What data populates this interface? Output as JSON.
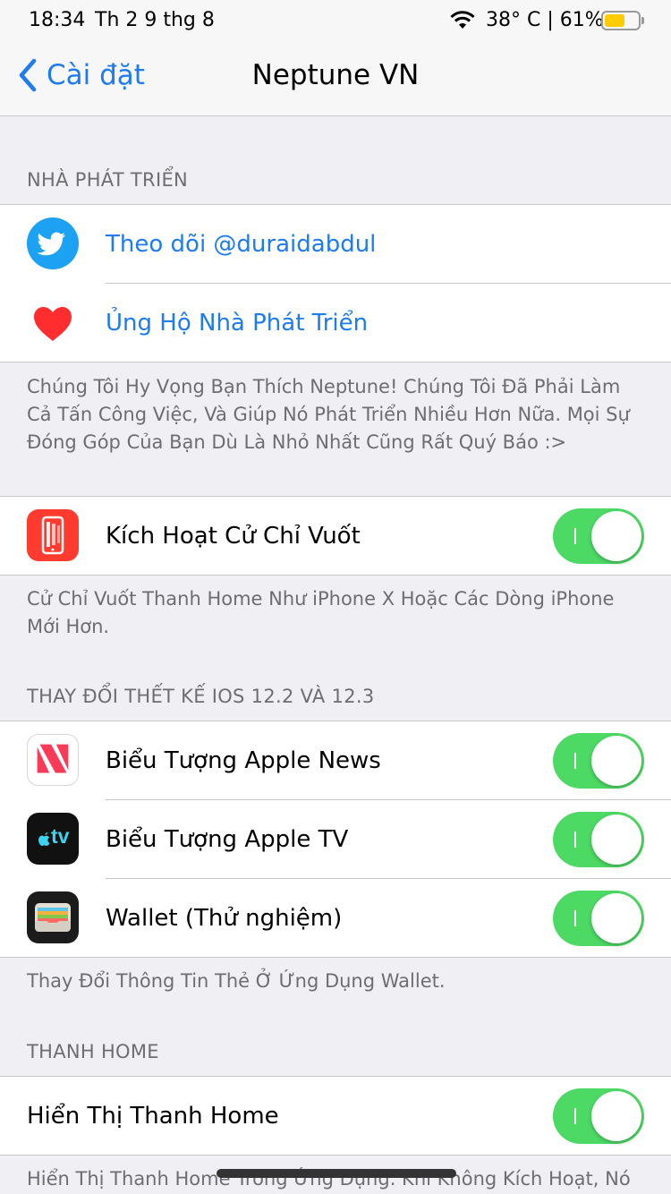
{
  "status_bar": {
    "time": "18:34",
    "date": "Th 2 9 thg 8",
    "temp_battery": "38° C | 61%",
    "battery_percent": 61
  },
  "nav": {
    "back_label": "Cài đặt",
    "title": "Neptune VN"
  },
  "developer": {
    "header": "NHÀ PHÁT TRIỂN",
    "twitter_label": "Theo dõi @duraidabdul",
    "support_label": "Ủng Hộ Nhà Phát Triển",
    "footer": "Chúng Tôi Hy Vọng Bạn Thích Neptune! Chúng Tôi Đã Phải Làm Cả Tấn Công Việc, Và Giúp Nó Phát Triển Nhiều Hơn Nữa. Mọi Sự Đóng Góp Của Bạn Dù Là Nhỏ Nhất Cũng Rất Quý Báo :>"
  },
  "gestures": {
    "label": "Kích Hoạt Cử Chỉ Vuốt",
    "enabled": true,
    "footer": "Cử Chỉ Vuốt Thanh Home Như iPhone X Hoặc Các Dòng iPhone Mới Hơn."
  },
  "redesign": {
    "header": "THAY ĐỔI THẾT KẾ IOS 12.2 VÀ 12.3",
    "items": [
      {
        "label": "Biểu Tượng Apple News",
        "enabled": true
      },
      {
        "label": "Biểu Tượng Apple TV",
        "enabled": true,
        "icon_text": "tv"
      },
      {
        "label": "Wallet (Thử nghiệm)",
        "enabled": true
      }
    ],
    "footer": "Thay Đổi Thông Tin Thẻ Ở Ứng Dụng Wallet."
  },
  "home_bar": {
    "header": "THANH HOME",
    "label": "Hiển Thị Thanh Home",
    "enabled": true,
    "footer": "Hiển Thị Thanh Home Trong Ứng Dụng. Khi Không Kích Hoạt, Nó"
  },
  "colors": {
    "accent": "#1e7bf0",
    "toggle_on": "#4cd964",
    "twitter": "#1da1f2",
    "heart": "#ff2d2d",
    "gesture_icon": "#ff3b30"
  },
  "icons": {
    "back": "chevron-left-icon",
    "twitter": "twitter-bird-icon",
    "support": "heart-icon",
    "gestures": "phone-swipe-icon",
    "news": "apple-news-icon",
    "tv": "apple-tv-icon",
    "wallet": "wallet-icon"
  }
}
